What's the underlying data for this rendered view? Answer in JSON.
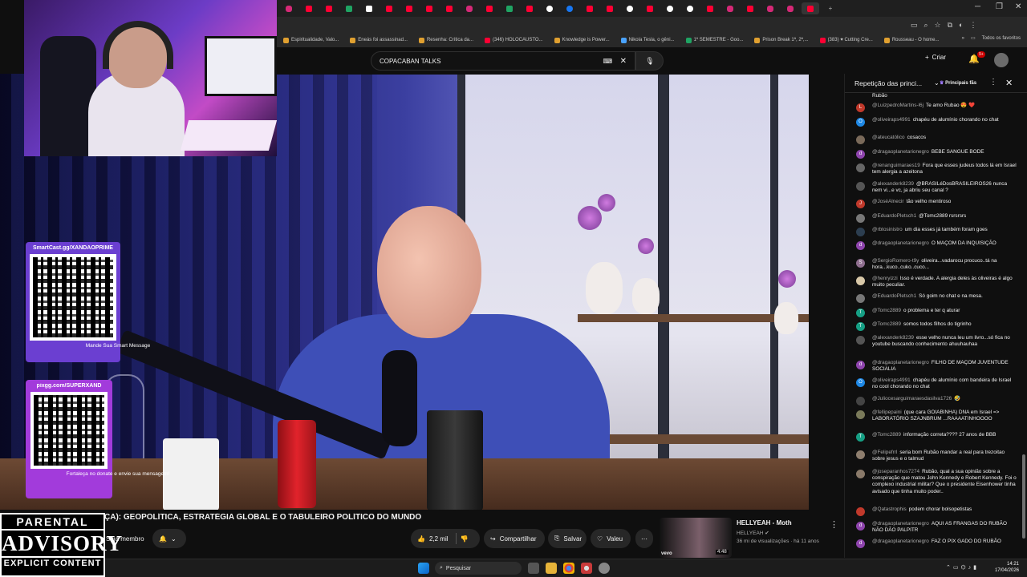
{
  "search": {
    "query": "COPACABAN TALKS"
  },
  "header": {
    "create_label": "Criar",
    "notif_count": "9+"
  },
  "bookmarks": [
    "Espiritualidade, Valo...",
    "Eneás foi assassinad...",
    "Resenha: Crítica da...",
    "(346) HOLOCAUSTO...",
    "Knowledge is Power...",
    "Nikola Tesla, o gêni...",
    "1º SEMESTRE - Goo...",
    "Prison Break 1ª, 2ª,...",
    "(383) ♥ Cutting Cre...",
    "Rousseau - O home..."
  ],
  "bookmarks_right": "Todos os favoritos",
  "overlay": {
    "qr1_url": "SmartCast.gg/XANDAOPRIME",
    "qr1_msg": "Mande Sua Smart Message",
    "qr2_url": "pixgg.com/SUPERXAND",
    "qr2_msg": "Fortaleça no donate e envie sua mensagem!"
  },
  "advisory": {
    "line1": "PARENTAL",
    "line2": "ADVISORY",
    "line3": "EXPLICIT CONTENT"
  },
  "video": {
    "title": "ÇA): GEOPOLÍTICA, ESTRATÉGIA GLOBAL E O TABULEIRO POLÍTICO DO MUNDO",
    "join_label": "Seja membro",
    "likes": "2,2 mil",
    "share_label": "Compartilhar",
    "save_label": "Salvar",
    "thanks_label": "Valeu"
  },
  "recommended": {
    "title": "HELLYEAH - Moth",
    "channel": "HELLYEAH",
    "meta": "36 mi de visualizações · há 11 anos",
    "duration": "4:48",
    "badge": "vevo"
  },
  "chat": {
    "header": "Repetição das princi...",
    "fan_label": "Principais fãs",
    "top_fragment": "Rubão",
    "messages": [
      {
        "author": "@LuizpedroMartins-l6j",
        "text": "Te amo Rubao 😍 ❤️",
        "initial": "L",
        "color": "#c0392b"
      },
      {
        "author": "@oliveiraps4991",
        "text": "chapéu de alumínio chorando no chat",
        "initial": "O",
        "color": "#1e88e5"
      },
      {
        "author": "@ateucatólico",
        "text": "cosacos",
        "initial": "",
        "color": "#7a6a5a"
      },
      {
        "author": "@dragaoplanetarionegro",
        "text": "BEBE SANGUE BODE",
        "initial": "d",
        "color": "#8e44ad"
      },
      {
        "author": "@renanguimaraes19",
        "text": "Fora que esses judeus todos lá em Israel tem alergia a azeitona",
        "initial": "",
        "color": "#666"
      },
      {
        "author": "@alexanderk8239",
        "text": "@BRASILéDosBRASILEIROS26 nunca nem vi...e vc, ja abriu seu canal ?",
        "initial": "",
        "color": "#555"
      },
      {
        "author": "@JoséAlnecir",
        "text": "tão velho mentiroso",
        "initial": "J",
        "color": "#c0392b"
      },
      {
        "author": "@EduardoPletsch1",
        "text": "@Tomc2889 rsrsrsrs",
        "initial": "",
        "color": "#777"
      },
      {
        "author": "@rbtosinistro",
        "text": "um dia esses já também foram goes",
        "initial": "",
        "color": "#2c3e50"
      },
      {
        "author": "@dragaoplanetarionegro",
        "text": "O MAÇOM DA INQUISIÇÃO",
        "initial": "d",
        "color": "#8e44ad"
      },
      {
        "author": "@SergioRomero-t9y",
        "text": "oliveira...vadarocu procuco..tá na hora...kuco..cuko..cuco...",
        "initial": "S",
        "color": "#8e6e8e"
      },
      {
        "author": "@henryizzi",
        "text": "Isso é verdade. A alergia deles às oliveiras é algo muito peculiar.",
        "initial": "",
        "color": "#d8c8a8"
      },
      {
        "author": "@EduardoPletsch1",
        "text": "Só goim no chat e na mesa.",
        "initial": "",
        "color": "#777"
      },
      {
        "author": "@Tomc2889",
        "text": "o problema e ter q aturar",
        "initial": "T",
        "color": "#16a085"
      },
      {
        "author": "@Tomc2889",
        "text": "somos todos filhos do tigrinho",
        "initial": "T",
        "color": "#16a085"
      },
      {
        "author": "@alexanderk8239",
        "text": "esse velho nunca leu um livro...só fica no youtube buscando conhecimento ahuuhauhaa",
        "initial": "",
        "color": "#555"
      },
      {
        "author": "@dragaoplanetarionegro",
        "text": "FILHO DE MAÇOM JUVENTUDE SOCIALIA",
        "initial": "d",
        "color": "#8e44ad"
      },
      {
        "author": "@oliveiraps4991",
        "text": "chapéu de alumínio com bandeira de Israel no cool chorando no chat",
        "initial": "O",
        "color": "#1e88e5"
      },
      {
        "author": "@Juliocesarguimaraesdasilva1726",
        "text": "🤣",
        "initial": "",
        "color": "#444"
      },
      {
        "author": "@fellipepaini",
        "text": "(que cara GOIABINHA) DNA em Israel => LABORATÓRIO SZAJNBRUM ...RAAAATINHOOOO",
        "initial": "",
        "color": "#7a7a5a"
      },
      {
        "author": "@Tomc2889",
        "text": "informação correta???? 27 anos de BBB",
        "initial": "T",
        "color": "#16a085"
      },
      {
        "author": "@Felipefrrl",
        "text": "seria bom Rubão mandar a real para trezoitao sobre jesus e o talmud",
        "initial": "",
        "color": "#8e7e6e"
      },
      {
        "author": "@joseparanhos7274",
        "text": "Rubão, qual a sua opinião sobre a conspiração que matou John Kennedy e Robert Kennedy. Foi o complexo industrial militar? Que o presidente Eisenhower tinha avisado que tinha muito poder..",
        "initial": "",
        "color": "#8a7a6a"
      },
      {
        "author": "@Qatastrophis",
        "text": "podem chorar bolsopetistas",
        "initial": "",
        "color": "#c0392b"
      },
      {
        "author": "@dragaoplanetarionegro",
        "text": "AQUI AS FRANGAS DO RUBÃO NÃO DÃO PALPITR",
        "initial": "d",
        "color": "#8e44ad"
      },
      {
        "author": "@dragaoplanetarionegro",
        "text": "FAZ O PIX GADO DO RUBÃO",
        "initial": "d",
        "color": "#8e44ad"
      }
    ]
  },
  "taskbar": {
    "search_label": "Pesquisar",
    "time": "14:21",
    "date": "17/04/2026"
  }
}
